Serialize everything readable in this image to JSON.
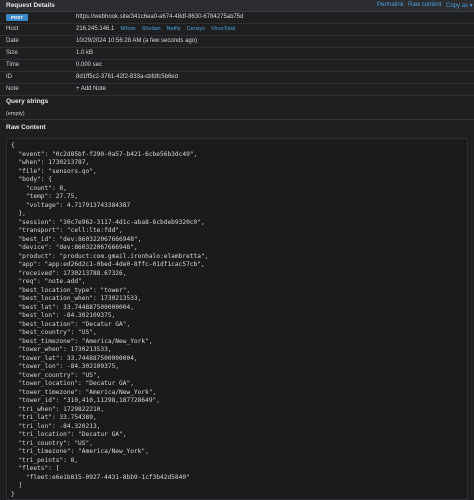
{
  "header": {
    "title": "Request Details",
    "permalink": "Permalink",
    "raw_content": "Raw content",
    "copy_as": "Copy as ▾"
  },
  "details": {
    "method": "POST",
    "url": "https://webhook.site/341c6ea0-a674-48df-8630-6784275ab75d",
    "host_label": "Host",
    "host_ip": "216.245.146.1",
    "host_links": [
      "Whois",
      "Shodan",
      "Netify",
      "Censys",
      "VirusTotal"
    ],
    "date_label": "Date",
    "date_value": "10/29/2024 10:56:28 AM (a few seconds ago)",
    "size_label": "Size",
    "size_value": "1.0 kB",
    "time_label": "Time",
    "time_value": "0.000 sec",
    "id_label": "ID",
    "id_value": "8d1ff5c2-3761-42f2-833a-cbfdfc5b6ed",
    "note_label": "Note",
    "add_note": "+ Add Note"
  },
  "query": {
    "title": "Query strings",
    "empty": "(empty)"
  },
  "raw": {
    "title": "Raw Content",
    "body": "{\n  \"event\": \"0c2d85bf-f290-0a57-b421-6cbe56b3dc49\",\n  \"when\": 1730213787,\n  \"file\": \"sensors.qo\",\n  \"body\": {\n    \"count\": 8,\n    \"temp\": 27.75,\n    \"voltage\": 4.717913743384387\n  },\n  \"session\": \"30c7e962-3117-4d1c-aba8-6cbdeb9320c0\",\n  \"transport\": \"cell:lte:fdd\",\n  \"best_id\": \"dev:860322067666948\",\n  \"device\": \"dev:860322067666948\",\n  \"product\": \"product:com.gmail.ironhalo:elambretta\",\n  \"app\": \"app:ed26d2c1-0bed-4de0-8ffc-01df1cac57cb\",\n  \"received\": 1730213788.67326,\n  \"req\": \"note.add\",\n  \"best_location_type\": \"tower\",\n  \"best_location_when\": 1730213533,\n  \"best_lat\": 33.744887500000004,\n  \"best_lon\": -84.302109375,\n  \"best_location\": \"Decatur GA\",\n  \"best_country\": \"US\",\n  \"best_timezone\": \"America/New_York\",\n  \"tower_when\": 1730213533,\n  \"tower_lat\": 33.744887500000004,\n  \"tower_lon\": -84.302109375,\n  \"tower_country\": \"US\",\n  \"tower_location\": \"Decatur GA\",\n  \"tower_timezone\": \"America/New_York\",\n  \"tower_id\": \"310,410,11298,187728649\",\n  \"tri_when\": 1729822210,\n  \"tri_lat\": 33.754389,\n  \"tri_lon\": -84.320213,\n  \"tri_location\": \"Decatur GA\",\n  \"tri_country\": \"US\",\n  \"tri_timezone\": \"America/New_York\",\n  \"tri_points\": 8,\n  \"fleets\": [\n    \"fleet:e6e1b815-0927-4431-8bb9-1cf3b42d5840\"\n  ]\n}"
  }
}
